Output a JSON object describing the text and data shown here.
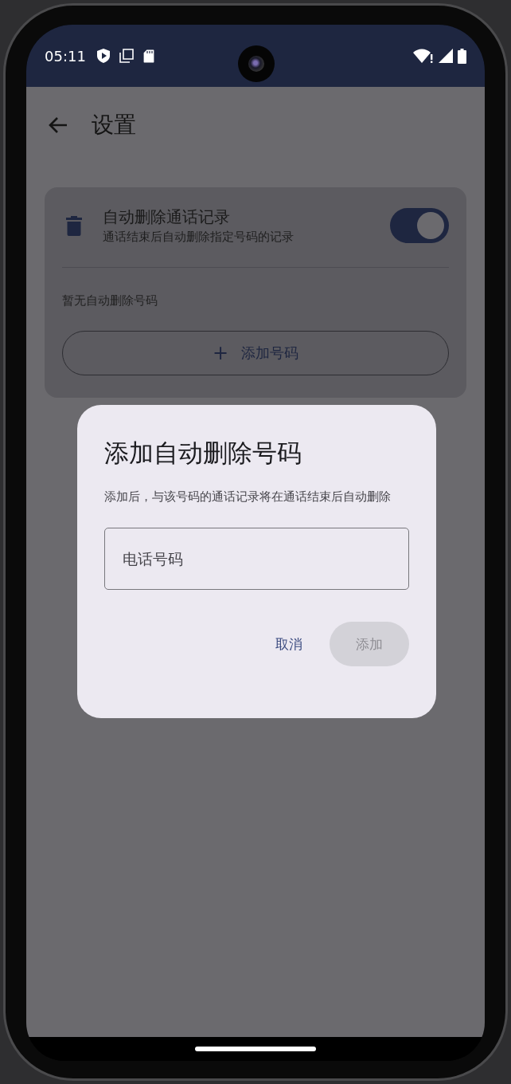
{
  "status_bar": {
    "time": "05:11"
  },
  "header": {
    "title": "设置"
  },
  "setting": {
    "title": "自动删除通话记录",
    "subtitle": "通话结束后自动删除指定号码的记录",
    "on": true
  },
  "empty_text": "暂无自动删除号码",
  "add_button": {
    "icon": "+",
    "label": "添加号码"
  },
  "dialog": {
    "title": "添加自动删除号码",
    "description": "添加后，与该号码的通话记录将在通话结束后自动删除",
    "field": {
      "placeholder": "电话号码"
    },
    "buttons": [
      {
        "label": "取消",
        "disabled": false
      },
      {
        "label": "添加",
        "disabled": true
      }
    ]
  }
}
